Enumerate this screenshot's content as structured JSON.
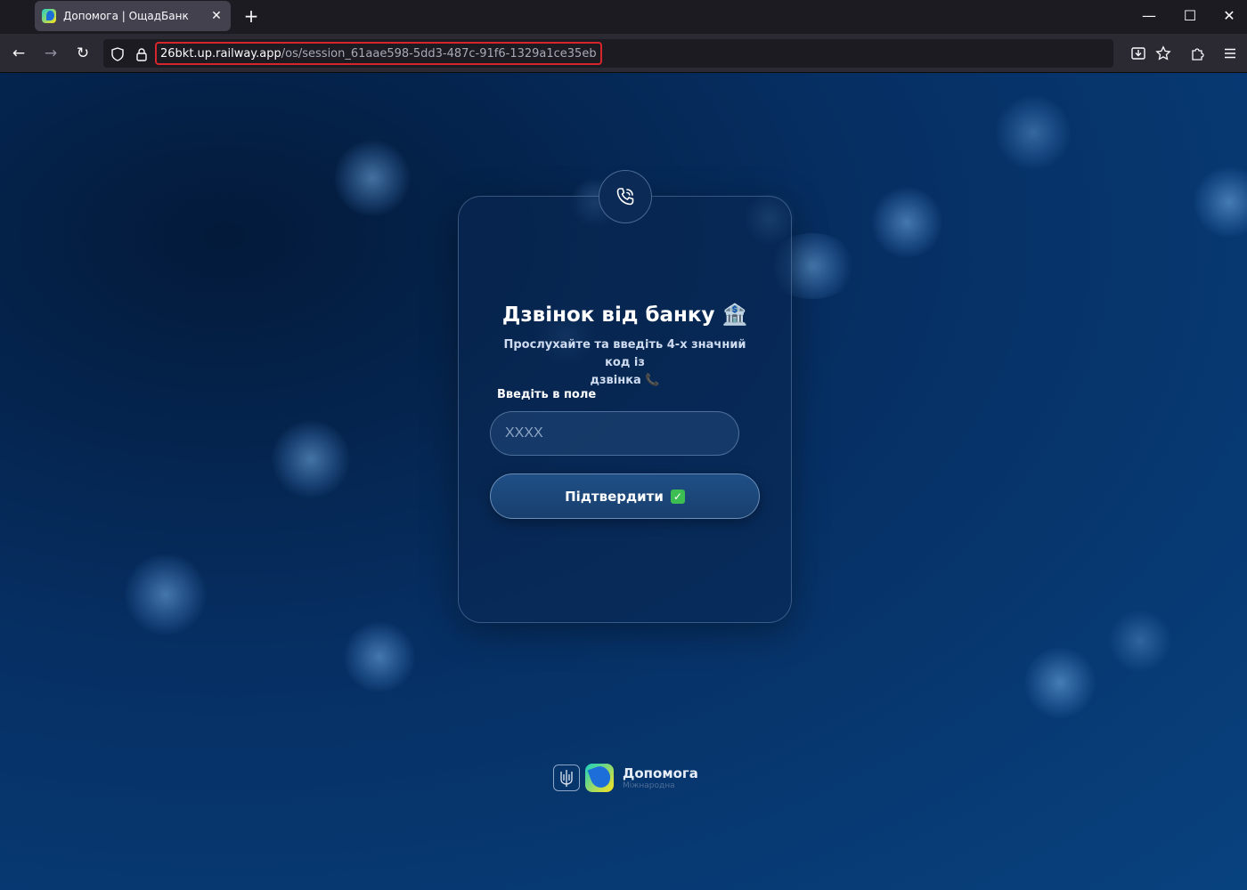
{
  "browser": {
    "tab": {
      "title": "Допомога | ОщадБанк",
      "close": "✕"
    },
    "new_tab": "+",
    "window_controls": {
      "minimize": "—",
      "maximize": "☐",
      "close": "✕"
    },
    "nav": {
      "back": "←",
      "forward": "→",
      "reload": "↻"
    },
    "url": {
      "host": "26bkt.up.railway.app",
      "path": "/os/session_61aae598-5dd3-487c-91f6-1329a1ce35eb"
    },
    "toolbar_icons": [
      "download-icon",
      "bookmark-star-icon",
      "extensions-icon",
      "menu-icon"
    ]
  },
  "card": {
    "title": "Дзвінок від банку 🏦",
    "subtitle_line1": "Прослухайте та введіть 4-х значний код із",
    "subtitle_line2": "дзвінка 📞",
    "field_label": "Введіть в поле",
    "input": {
      "value": "",
      "placeholder": "XXXX"
    },
    "confirm_label": "Підтвердити",
    "confirm_emoji": "✓"
  },
  "footer": {
    "brand_name": "Допомога",
    "brand_sub": "Міжнародна"
  },
  "colors": {
    "page_bg": "#062f63",
    "accent_url_outline": "#d7262b",
    "brand_teal": "#19d0c3",
    "brand_yellow": "#ffe31c",
    "brand_blue": "#1d6ed8"
  }
}
